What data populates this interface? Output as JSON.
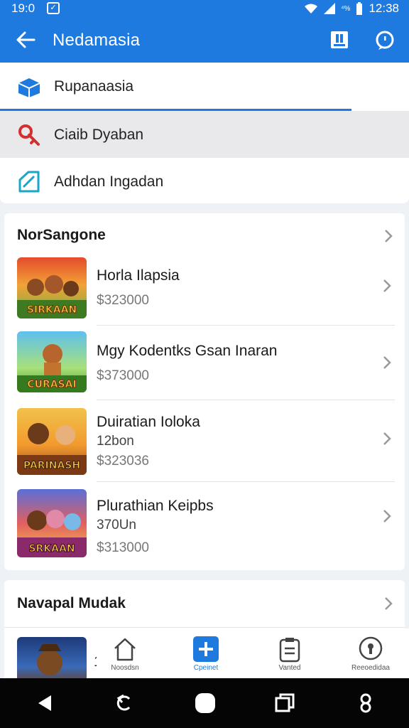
{
  "status_bar": {
    "time_left": "19:0",
    "battery_pct_label": "⁴%",
    "time_right": "12:38"
  },
  "app_bar": {
    "title": "Nedamasia",
    "back_icon": "back-arrow-icon",
    "actions": [
      "bookmark-icon",
      "chat-bubble-icon"
    ]
  },
  "menu": {
    "items": [
      {
        "label": "Rupanaasia",
        "icon": "folder-box-icon",
        "color": "#1f7ae0"
      },
      {
        "label": "Ciaib Dyaban",
        "icon": "key-icon",
        "color": "#d32f2f"
      },
      {
        "label": "Adhdan Ingadan",
        "icon": "edit-pencil-icon",
        "color": "#1aa6c9"
      }
    ],
    "progress_fraction": 0.86
  },
  "section_one": {
    "title": "NorSangone",
    "items": [
      {
        "title": "Horla Ilapsia",
        "sub": "",
        "price": "$323000",
        "banner": "SIRKAAN"
      },
      {
        "title": "Mgy Kodentks Gsan Inaran",
        "sub": "",
        "price": "$373000",
        "banner": "CURASAI"
      },
      {
        "title": "Duiratian Ioloka",
        "sub": "12bon",
        "price": "$323036",
        "banner": "PARINASH"
      },
      {
        "title": "Plurathian Keipbs",
        "sub": "370Un",
        "price": "$313000",
        "banner": "SRKAAN"
      }
    ]
  },
  "section_two": {
    "title": "Navapal Mudak",
    "item_number": "1"
  },
  "bottom_nav": {
    "items": [
      {
        "label": "Noosdsn",
        "icon": "home-icon"
      },
      {
        "label": "Cpeinet",
        "icon": "add-plus-icon"
      },
      {
        "label": "Vanted",
        "icon": "clipboard-icon"
      },
      {
        "label": "Reeoedidaa",
        "icon": "profile-pin-icon"
      }
    ]
  },
  "colors": {
    "primary": "#1f7ae0",
    "background": "#eef1f5",
    "card": "#ffffff"
  }
}
